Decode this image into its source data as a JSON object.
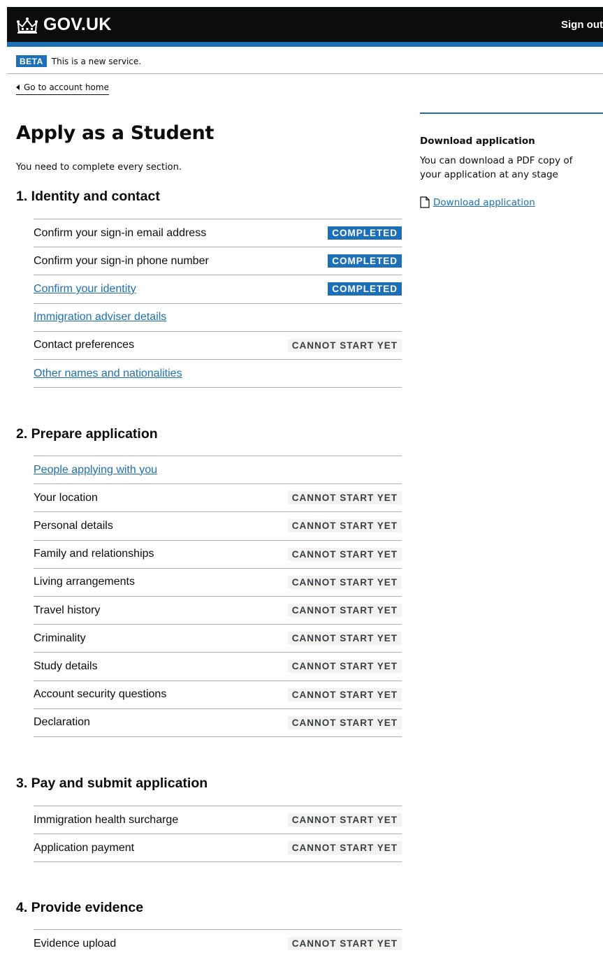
{
  "header": {
    "logo_text": "GOV.UK",
    "sign_out": "Sign out"
  },
  "phase_banner": {
    "tag": "BETA",
    "text": "This is a new service."
  },
  "back_link": "Go to account home",
  "page": {
    "title": "Apply as a Student",
    "intro": "You need to complete every section."
  },
  "sections": [
    {
      "title": "1. Identity and contact",
      "tasks": [
        {
          "name": "Confirm your sign-in email address",
          "link": false,
          "status": "COMPLETED"
        },
        {
          "name": "Confirm your sign-in phone number",
          "link": false,
          "status": "COMPLETED"
        },
        {
          "name": "Confirm your identity",
          "link": true,
          "status": "COMPLETED"
        },
        {
          "name": "Immigration adviser details",
          "link": true,
          "status": ""
        },
        {
          "name": "Contact preferences",
          "link": false,
          "status": "CANNOT START YET"
        },
        {
          "name": "Other names and nationalities",
          "link": true,
          "status": ""
        }
      ]
    },
    {
      "title": "2. Prepare application",
      "tasks": [
        {
          "name": "People applying with you",
          "link": true,
          "status": ""
        },
        {
          "name": "Your location",
          "link": false,
          "status": "CANNOT START YET"
        },
        {
          "name": "Personal details",
          "link": false,
          "status": "CANNOT START YET"
        },
        {
          "name": "Family and relationships",
          "link": false,
          "status": "CANNOT START YET"
        },
        {
          "name": "Living arrangements",
          "link": false,
          "status": "CANNOT START YET"
        },
        {
          "name": "Travel history",
          "link": false,
          "status": "CANNOT START YET"
        },
        {
          "name": "Criminality",
          "link": false,
          "status": "CANNOT START YET"
        },
        {
          "name": "Study details",
          "link": false,
          "status": "CANNOT START YET"
        },
        {
          "name": "Account security questions",
          "link": false,
          "status": "CANNOT START YET"
        },
        {
          "name": "Declaration",
          "link": false,
          "status": "CANNOT START YET"
        }
      ]
    },
    {
      "title": "3. Pay and submit application",
      "tasks": [
        {
          "name": "Immigration health surcharge",
          "link": false,
          "status": "CANNOT START YET"
        },
        {
          "name": "Application payment",
          "link": false,
          "status": "CANNOT START YET"
        }
      ]
    },
    {
      "title": "4. Provide evidence",
      "tasks": [
        {
          "name": "Evidence upload",
          "link": false,
          "status": "CANNOT START YET"
        }
      ]
    }
  ],
  "aside": {
    "heading": "Download application",
    "body": "You can download a PDF copy of your application at any stage",
    "link_text": "Download application",
    "link_icon": "document-icon"
  },
  "colors": {
    "header_bg": "#0b0c0c",
    "brand_blue": "#1d70b8",
    "tag_grey_bg": "#f3f2f1",
    "tag_grey_text": "#383f43",
    "rule": "#b1b4b6"
  }
}
